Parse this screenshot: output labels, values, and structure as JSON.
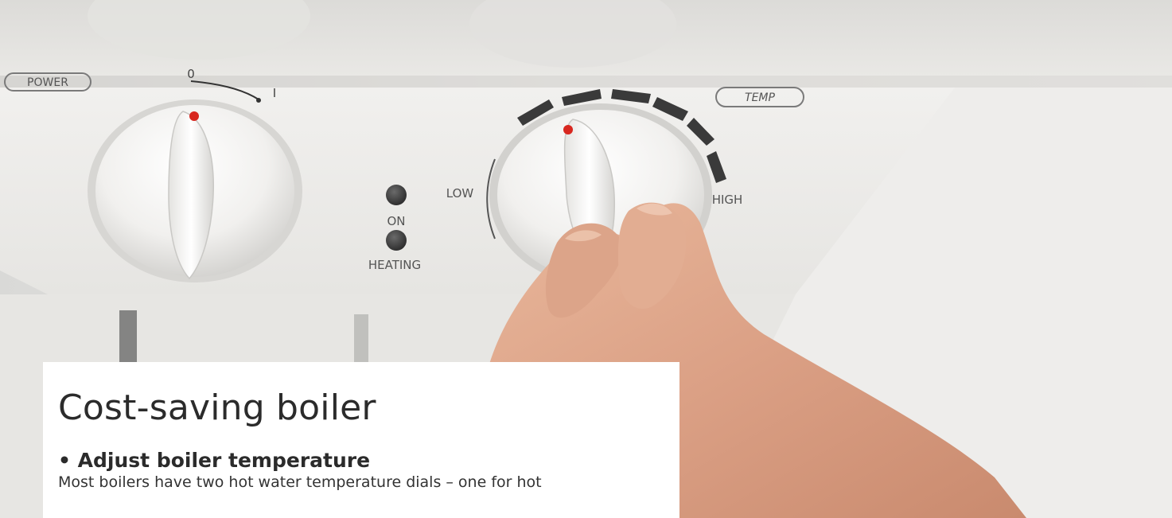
{
  "panel": {
    "power_label": "POWER",
    "power_scale_zero": "0",
    "power_scale_one": "I",
    "temp_label": "TEMP",
    "low_label": "LOW",
    "high_label": "HIGH",
    "on_label": "ON",
    "heating_label": "HEATING"
  },
  "card": {
    "title": "Cost-saving boiler",
    "subheading": "• Adjust boiler temperature",
    "body": "Most boilers have two hot water temperature dials – one for hot"
  },
  "colors": {
    "indicator_red": "#d8271f",
    "scale_bar_dark": "#3a3a3a",
    "card_background": "#ffffff",
    "card_text": "#2b2b2b"
  },
  "icons": {
    "power_knob": "power-dial-icon",
    "temp_knob": "temperature-dial-icon",
    "on_lamp": "on-indicator-lamp-icon",
    "heating_lamp": "heating-indicator-lamp-icon"
  }
}
